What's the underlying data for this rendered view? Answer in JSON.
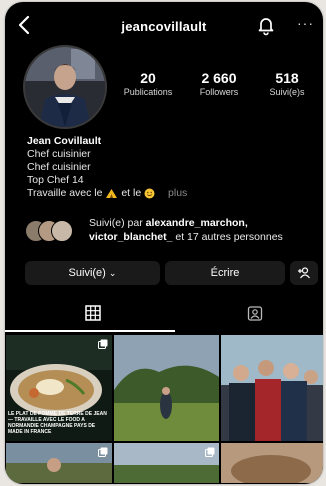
{
  "header": {
    "username": "jeancovillault",
    "back_icon": "chevron-left-icon",
    "bell_icon": "bell-icon",
    "more_icon": "ellipsis-icon"
  },
  "stats": [
    {
      "value": "20",
      "label": "Publications"
    },
    {
      "value": "2 660",
      "label": "Followers"
    },
    {
      "value": "518",
      "label": "Suivi(e)s"
    }
  ],
  "bio": {
    "name": "Jean Covillault",
    "line1": "Chef cuisinier",
    "line2": "Chef cuisinier",
    "line3": "Top Chef 14",
    "line4_prefix": "Travaille avec le",
    "line4_mid": "et le",
    "more": "plus"
  },
  "followed_by": {
    "prefix": "Suivi(e) par",
    "user1": "alexandre_marchon,",
    "user2": "victor_blanchet_",
    "suffix": "et 17 autres personnes"
  },
  "actions": {
    "follow": "Suivi(e)",
    "message": "Écrire"
  },
  "tabs": {
    "grid_icon": "grid-icon",
    "tagged_icon": "tagged-person-icon"
  },
  "posts": [
    {
      "caption": "LE PLAT DE POMME DE TERRE DE JEAN — TRAVAILLE AVEC LE FOOD A NORMANDIE CHAMPAGNE PAYS DE MADE IN FRANCE"
    }
  ],
  "colors": {
    "background": "#000000",
    "text": "#ffffff",
    "button": "#1a1a1a",
    "page": "#e9e6e2"
  }
}
